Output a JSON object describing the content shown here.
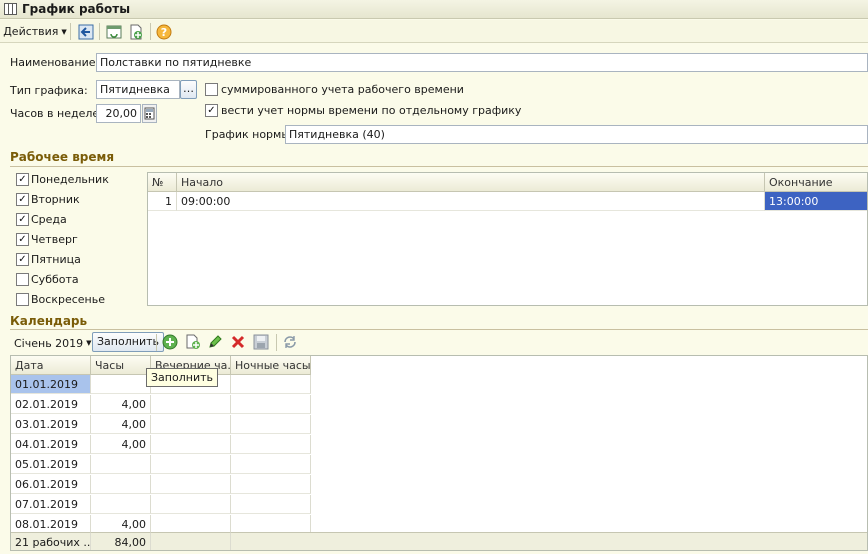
{
  "window": {
    "title": "График работы"
  },
  "toolbar": {
    "actions_label": "Действия"
  },
  "form": {
    "name_label": "Наименование:",
    "name_value": "Полставки по пятидневке",
    "type_label": "Тип графика:",
    "type_value": "Пятидневка",
    "hours_label": "Часов в неделе:",
    "hours_value": "20,00",
    "summ_label": "суммированного учета рабочего времени",
    "summ_checked": false,
    "norm_label": "вести учет нормы времени по отдельному графику",
    "norm_checked": true,
    "norm_schedule_label": "График нормы:",
    "norm_schedule_value": "Пятидневка (40)"
  },
  "work_time": {
    "section_title": "Рабочее время",
    "days": [
      {
        "label": "Понедельник",
        "checked": true
      },
      {
        "label": "Вторник",
        "checked": true
      },
      {
        "label": "Среда",
        "checked": true
      },
      {
        "label": "Четверг",
        "checked": true
      },
      {
        "label": "Пятница",
        "checked": true
      },
      {
        "label": "Суббота",
        "checked": false
      },
      {
        "label": "Воскресенье",
        "checked": false
      }
    ],
    "table": {
      "headers": {
        "num": "№",
        "start": "Начало",
        "end": "Окончание"
      },
      "rows": [
        {
          "num": "1",
          "start": "09:00:00",
          "end": "13:00:00"
        }
      ]
    }
  },
  "calendar": {
    "section_title": "Календарь",
    "month": "Січень 2019",
    "fill_button": "Заполнить",
    "tooltip": "Заполнить",
    "headers": {
      "date": "Дата",
      "hours": "Часы",
      "evening": "Вечерние ча...",
      "night": "Ночные часы"
    },
    "rows": [
      {
        "date": "01.01.2019",
        "hours": ""
      },
      {
        "date": "02.01.2019",
        "hours": "4,00"
      },
      {
        "date": "03.01.2019",
        "hours": "4,00"
      },
      {
        "date": "04.01.2019",
        "hours": "4,00"
      },
      {
        "date": "05.01.2019",
        "hours": ""
      },
      {
        "date": "06.01.2019",
        "hours": ""
      },
      {
        "date": "07.01.2019",
        "hours": ""
      },
      {
        "date": "08.01.2019",
        "hours": "4,00"
      }
    ],
    "footer": {
      "date": "21 рабочих ...",
      "hours": "84,00"
    }
  },
  "colors": {
    "selection": "#3d63c2",
    "section_title": "#7a5c08"
  }
}
